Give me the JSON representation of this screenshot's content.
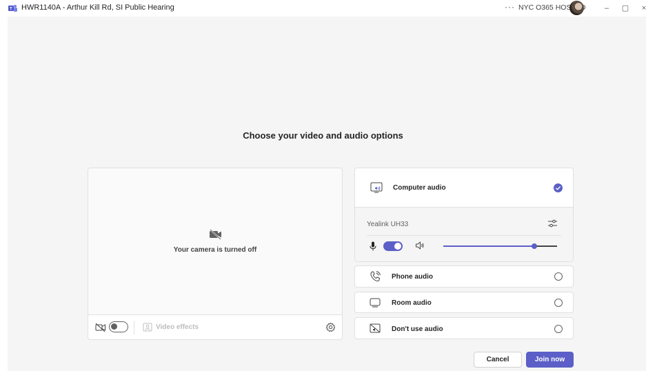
{
  "window": {
    "title": "HWR1140A - Arthur Kill Rd, SI Public Hearing",
    "more_label": "···",
    "org": "NYC O365 HOSTED",
    "minimize_label": "–",
    "maximize_label": "▢",
    "close_label": "×"
  },
  "main": {
    "heading": "Choose your video and audio options"
  },
  "video": {
    "camera_status": "Your camera is turned off",
    "camera_toggle_on": false,
    "effects_label": "Video effects"
  },
  "audio": {
    "computer": {
      "label": "Computer audio",
      "selected": true
    },
    "device_name": "Yealink UH33",
    "mic_on": true,
    "speaker_volume": 0.8,
    "phone": {
      "label": "Phone audio"
    },
    "room": {
      "label": "Room audio"
    },
    "none": {
      "label": "Don't use audio"
    }
  },
  "actions": {
    "cancel_label": "Cancel",
    "join_label": "Join now"
  },
  "colors": {
    "accent": "#5b5fc7",
    "background": "#f5f5f5"
  }
}
